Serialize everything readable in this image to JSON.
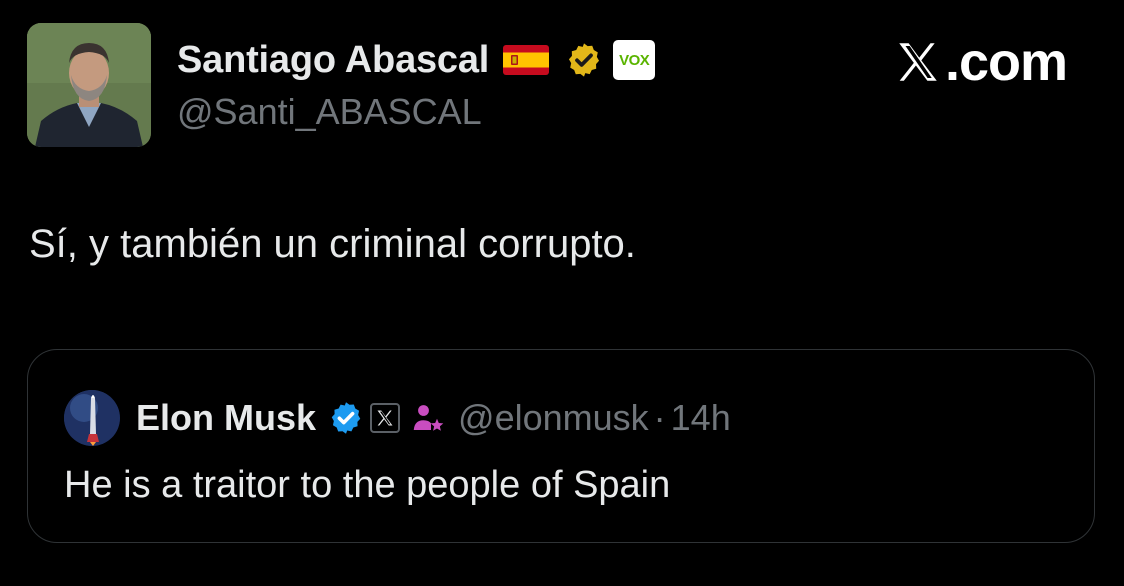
{
  "tweet": {
    "author": {
      "name": "Santiago Abascal",
      "handle": "@Santi_ABASCAL",
      "flag_emoji": "🇪🇸",
      "verified_badge": "gold-verified-icon",
      "affiliate_badge": "VOX"
    },
    "text": "Sí, y también un criminal corrupto."
  },
  "brand": {
    "icon": "x-logo-icon",
    "label": "X.com",
    "label_suffix": ".com"
  },
  "quoted_tweet": {
    "author": {
      "name": "Elon Musk",
      "handle": "@elonmusk",
      "verified_badge": "blue-verified-icon",
      "affiliate_badge": "x-logo-icon",
      "extra_icon": "affiliate-person-icon"
    },
    "separator": "·",
    "time": "14h",
    "text": "He is a traitor to the people of Spain"
  },
  "colors": {
    "background": "#000000",
    "text_primary": "#e7e9ea",
    "text_secondary": "#71767b",
    "border": "#2f3336",
    "verified_blue": "#1d9bf0",
    "verified_gold": "#e2b719",
    "vox_green": "#5ab400",
    "affiliate_purple": "#c94dc0"
  }
}
